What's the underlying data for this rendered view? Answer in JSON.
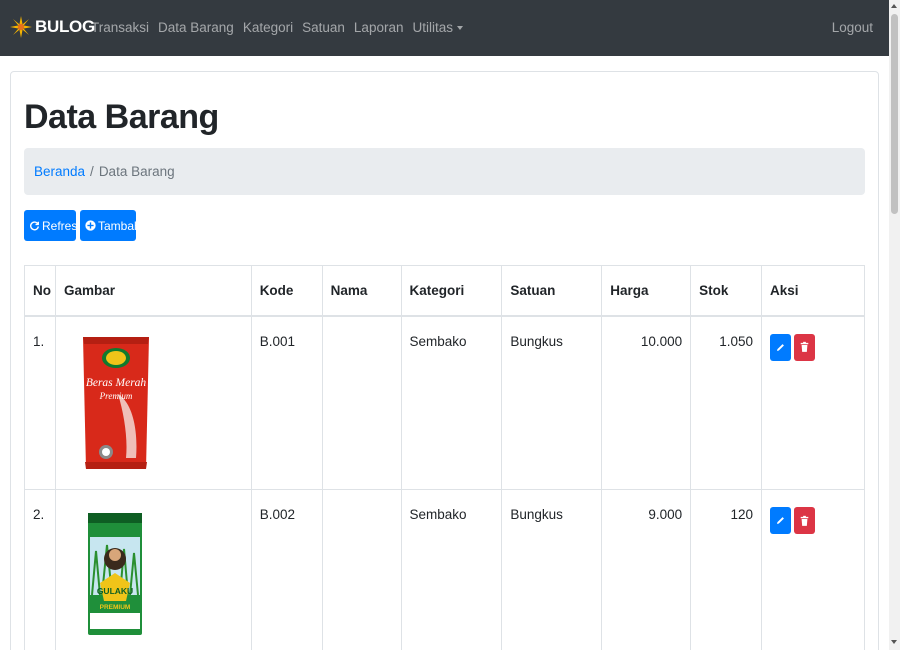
{
  "navbar": {
    "brand": "BULOG",
    "links": [
      "Transaksi",
      "Data Barang",
      "Kategori",
      "Satuan",
      "Laporan"
    ],
    "dropdown": "Utilitas",
    "logout": "Logout"
  },
  "page": {
    "title": "Data Barang",
    "breadcrumb": {
      "home": "Beranda",
      "separator": "/",
      "current": "Data Barang"
    },
    "buttons": {
      "refresh": "Refresh",
      "tambah": "Tambah"
    }
  },
  "table": {
    "headers": [
      "No",
      "Gambar",
      "Kode",
      "Nama",
      "Kategori",
      "Satuan",
      "Harga",
      "Stok",
      "Aksi"
    ],
    "rows": [
      {
        "no": "1.",
        "kode": "B.001",
        "nama": "",
        "kategori": "Sembako",
        "satuan": "Bungkus",
        "harga": "10.000",
        "stok": "1.050",
        "image": {
          "line1": "Beras Merah",
          "line2": "Premium"
        }
      },
      {
        "no": "2.",
        "kode": "B.002",
        "nama": "",
        "kategori": "Sembako",
        "satuan": "Bungkus",
        "harga": "9.000",
        "stok": "120",
        "image": {
          "line1": "GULAKU",
          "line2": "PREMIUM"
        }
      }
    ]
  },
  "colors": {
    "navbar": "#343a40",
    "primary": "#007bff",
    "danger": "#dc3545",
    "breadcrumb_bg": "#e9ecef"
  },
  "icons": {
    "brand": "sun-logo-icon",
    "refresh": "refresh-icon",
    "tambah": "plus-circle-icon",
    "edit": "pencil-icon",
    "delete": "trash-icon"
  }
}
